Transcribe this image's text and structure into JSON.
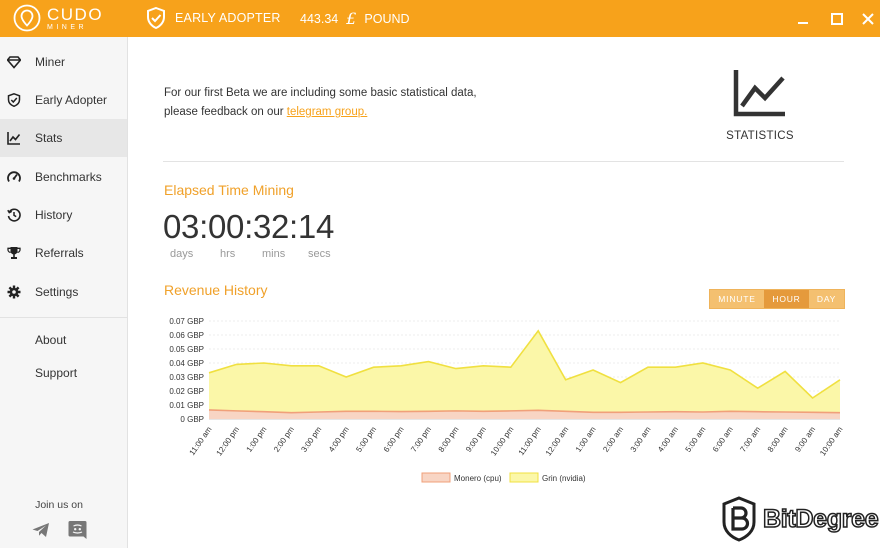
{
  "app": {
    "logo_line1": "CUDO",
    "logo_line2": "MINER",
    "badge_label": "EARLY ADOPTER",
    "balance_value": "443.34",
    "currency_symbol": "£",
    "currency_name": "POUND",
    "accent_color": "#f7a21b"
  },
  "sidebar": {
    "items": [
      {
        "label": "Miner",
        "icon": "diamond-icon"
      },
      {
        "label": "Early Adopter",
        "icon": "shield-icon"
      },
      {
        "label": "Stats",
        "icon": "chart-icon"
      },
      {
        "label": "Benchmarks",
        "icon": "gauge-icon"
      },
      {
        "label": "History",
        "icon": "history-icon"
      },
      {
        "label": "Referrals",
        "icon": "trophy-icon"
      },
      {
        "label": "Settings",
        "icon": "gear-icon"
      }
    ],
    "about": "About",
    "support": "Support",
    "join_label": "Join us on"
  },
  "main": {
    "intro_line1": "For our first Beta we are including some basic statistical data,",
    "intro_line2_prefix": "please feedback on our ",
    "intro_link": "telegram group.",
    "stats_label": "STATISTICS",
    "elapsed_title": "Elapsed Time Mining",
    "elapsed_value": "03:00:32:14",
    "units": [
      "days",
      "hrs",
      "mins",
      "secs"
    ],
    "revenue_title": "Revenue History",
    "range_buttons": [
      "MINUTE",
      "HOUR",
      "DAY"
    ],
    "range_selected": "HOUR"
  },
  "watermark": "BitDegree",
  "chart_data": {
    "type": "area",
    "title": "Revenue History",
    "x": [
      "11:00 am",
      "12:00 pm",
      "1:00 pm",
      "2:00 pm",
      "3:00 pm",
      "4:00 pm",
      "5:00 pm",
      "6:00 pm",
      "7:00 pm",
      "8:00 pm",
      "9:00 pm",
      "10:00 pm",
      "11:00 pm",
      "12:00 am",
      "1:00 am",
      "2:00 am",
      "3:00 am",
      "4:00 am",
      "5:00 am",
      "6:00 am",
      "7:00 am",
      "8:00 am",
      "9:00 am",
      "10:00 am"
    ],
    "series": [
      {
        "name": "Monero (cpu)",
        "color": "#f0a07a",
        "fill": "#f8d5c4",
        "values": [
          0.0065,
          0.0058,
          0.0052,
          0.0045,
          0.005,
          0.0055,
          0.0055,
          0.0053,
          0.0055,
          0.0058,
          0.0055,
          0.0058,
          0.0062,
          0.0055,
          0.0048,
          0.0048,
          0.005,
          0.0052,
          0.005,
          0.0055,
          0.0052,
          0.005,
          0.0048,
          0.0045
        ]
      },
      {
        "name": "Grin (nvidia)",
        "color": "#f0e040",
        "fill": "#fbf7a8",
        "values": [
          0.033,
          0.039,
          0.04,
          0.038,
          0.038,
          0.03,
          0.037,
          0.038,
          0.041,
          0.036,
          0.038,
          0.037,
          0.063,
          0.028,
          0.035,
          0.026,
          0.037,
          0.037,
          0.04,
          0.035,
          0.022,
          0.034,
          0.015,
          0.028
        ]
      }
    ],
    "yticks": [
      "0 GBP",
      "0.01 GBP",
      "0.02 GBP",
      "0.03 GBP",
      "0.04 GBP",
      "0.05 GBP",
      "0.06 GBP",
      "0.07 GBP"
    ],
    "ylim": [
      0,
      0.07
    ],
    "grid": true,
    "legend_position": "bottom"
  }
}
